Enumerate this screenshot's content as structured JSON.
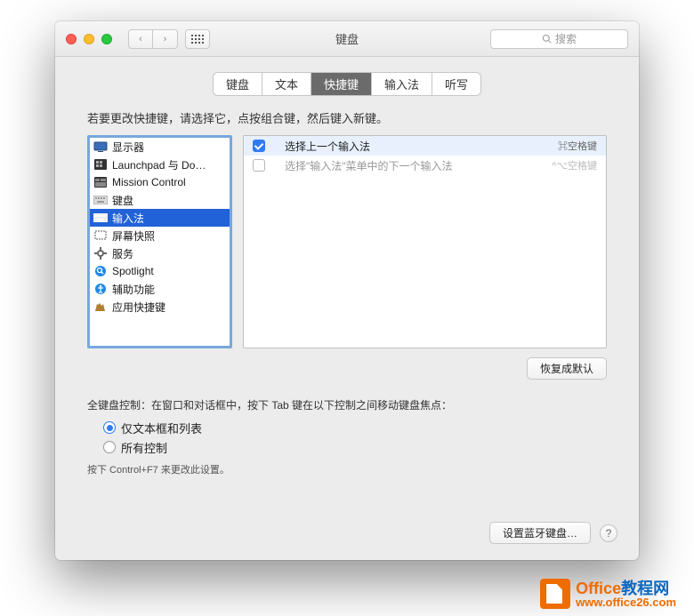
{
  "window": {
    "title": "键盘"
  },
  "search": {
    "placeholder": "搜索"
  },
  "tabs": [
    {
      "label": "键盘"
    },
    {
      "label": "文本"
    },
    {
      "label": "快捷键",
      "active": true
    },
    {
      "label": "输入法"
    },
    {
      "label": "听写"
    }
  ],
  "instruction": "若要更改快捷键，请选择它，点按组合键，然后键入新键。",
  "sidebar": {
    "items": [
      {
        "label": "显示器"
      },
      {
        "label": "Launchpad 与 Do…"
      },
      {
        "label": "Mission Control"
      },
      {
        "label": "键盘"
      },
      {
        "label": "输入法",
        "selected": true
      },
      {
        "label": "屏幕快照"
      },
      {
        "label": "服务"
      },
      {
        "label": "Spotlight"
      },
      {
        "label": "辅助功能"
      },
      {
        "label": "应用快捷键"
      }
    ]
  },
  "shortcuts": [
    {
      "checked": true,
      "label": "选择上一个输入法",
      "keys": "⌘空格键",
      "selected": true
    },
    {
      "checked": false,
      "label": "选择\"输入法\"菜单中的下一个输入法",
      "keys": "^⌥空格键",
      "dim": true
    }
  ],
  "buttons": {
    "restore": "恢复成默认",
    "bluetooth": "设置蓝牙键盘…"
  },
  "fullkb": {
    "desc": "全键盘控制：在窗口和对话框中，按下 Tab 键在以下控制之间移动键盘焦点：",
    "opt1": "仅文本框和列表",
    "opt2": "所有控制",
    "hint": "按下 Control+F7 来更改此设置。"
  },
  "watermark": {
    "line1a": "Office",
    "line1b": "教程网",
    "line2": "www.office26.com"
  }
}
